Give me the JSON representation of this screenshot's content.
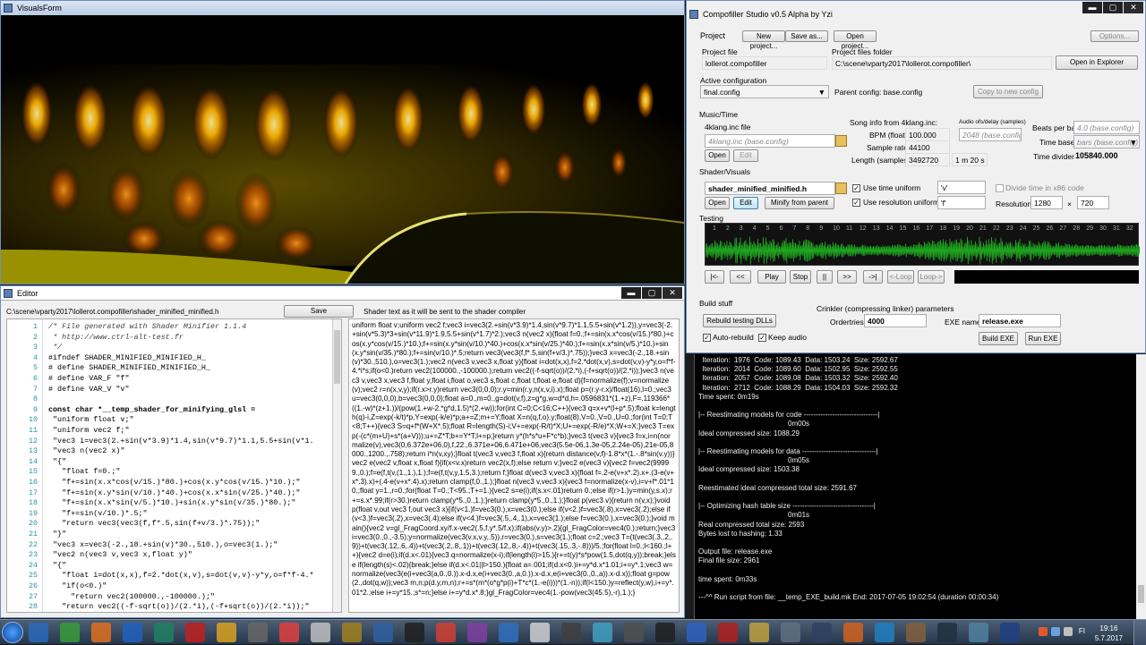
{
  "visuals": {
    "title": "VisualsForm"
  },
  "editor": {
    "title": "Editor",
    "path": "C:\\scene\\vparty2017\\lollerot.compofiller\\shader_minified_minified.h",
    "save_label": "Save",
    "shader_note": "Shader text as it will be sent to the shader compiler",
    "lines": [
      {
        "n": "1",
        "t": "/* File generated with Shader Minifier 1.1.4",
        "c": "cm"
      },
      {
        "n": "2",
        "t": " * http://www.ctrl-alt-test.fr",
        "c": "cm"
      },
      {
        "n": "3",
        "t": " */",
        "c": "cm"
      },
      {
        "n": "4",
        "t": "#ifndef SHADER_MINIFIED_MINIFIED_H_",
        "c": ""
      },
      {
        "n": "5",
        "t": "# define SHADER_MINIFIED_MINIFIED_H_",
        "c": ""
      },
      {
        "n": "6",
        "t": "# define VAR_F \"f\"",
        "c": ""
      },
      {
        "n": "7",
        "t": "# define VAR_V \"v\"",
        "c": ""
      },
      {
        "n": "8",
        "t": "",
        "c": ""
      },
      {
        "n": "9",
        "t": "const char *__temp_shader_for_minifying_glsl =",
        "c": "kw"
      },
      {
        "n": "10",
        "t": " \"uniform float v;\"",
        "c": ""
      },
      {
        "n": "11",
        "t": " \"uniform vec2 f;\"",
        "c": ""
      },
      {
        "n": "12",
        "t": " \"vec3 i=vec3(2.+sin(v*3.9)*1.4,sin(v*9.7)*1.1,5.5+sin(v*1.",
        "c": ""
      },
      {
        "n": "13",
        "t": " \"vec3 n(vec2 x)\"",
        "c": ""
      },
      {
        "n": "14",
        "t": " \"{\"",
        "c": ""
      },
      {
        "n": "15",
        "t": "   \"float f=0.;\"",
        "c": ""
      },
      {
        "n": "16",
        "t": "   \"f+=sin(x.x*cos(v/15.)*80.)+cos(x.y*cos(v/15.)*10.);\"",
        "c": ""
      },
      {
        "n": "17",
        "t": "   \"f+=sin(x.y*sin(v/10.)*40.)+cos(x.x*sin(v/25.)*40.);\"",
        "c": ""
      },
      {
        "n": "18",
        "t": "   \"f+=sin(x.x*sin(v/5.)*10.)+sin(x.y*sin(v/35.)*80.);\"",
        "c": ""
      },
      {
        "n": "19",
        "t": "   \"f+=sin(v/10.)*.5;\"",
        "c": ""
      },
      {
        "n": "20",
        "t": "   \"return vec3(vec3(f,f*.5,sin(f+v/3.)*.75));\"",
        "c": ""
      },
      {
        "n": "21",
        "t": " \"}\"",
        "c": ""
      },
      {
        "n": "22",
        "t": " \"vec3 x=vec3(-2.,18.+sin(v)*30.,510.),o=vec3(1.);\"",
        "c": ""
      },
      {
        "n": "23",
        "t": " \"vec2 n(vec3 v,vec3 x,float y)\"",
        "c": ""
      },
      {
        "n": "24",
        "t": " \"{\"",
        "c": ""
      },
      {
        "n": "25",
        "t": "   \"float i=dot(x,x),f=2.*dot(x,v),s=dot(v,v)-y*y,o=f*f-4.*",
        "c": ""
      },
      {
        "n": "26",
        "t": "   \"if(o<0.)\"",
        "c": ""
      },
      {
        "n": "27",
        "t": "     \"return vec2(100000.,-100000.);\"",
        "c": ""
      },
      {
        "n": "28",
        "t": "   \"return vec2((-f-sqrt(o))/(2.*i),(-f+sqrt(o))/(2.*i));\"",
        "c": ""
      }
    ],
    "output": "uniform float v;uniform vec2 f;vec3 i=vec3(2.+sin(v*3.9)*1.4,sin(v*9.7)*1.1,5.5+sin(v*1.2)),y=vec3(-2.+sin(v*5.3)*3+sin(v*11.9)*1.9,5.5+sin(v*1.7)*2.);vec3 n(vec2 x){float f=0.;f+=sin(x.x*cos(v/15.)*80.)+cos(x.y*cos(v/15.)*10.);f+=sin(x.y*sin(v/10.)*40.)+cos(x.x*sin(v/25.)*40.);f+=sin(x.x*sin(v/5.)*10.)+sin(x.y*sin(v/35.)*80.);f+=sin(v/10.)*.5;return vec3(vec3(f,f*.5,sin(f+v/3.)*.75));}vec3 x=vec3(-2.,18.+sin(v)*30.,510.),o=vec3(1.);vec2 n(vec3 v,vec3 x,float y){float i=dot(x,x),f=2.*dot(x,v),s=dot(v,v)-y*y,o=f*f-4.*i*s;if(o<0.)return vec2(100000.,-100000.);return vec2((-f-sqrt(o))/(2.*i),(-f+sqrt(o))/(2.*i));}vec3 n(vec3 v,vec3 x,vec3 f,float y,float i,float o,vec3 s,float c,float t,float e,float d){f=normalize(f);v=normalize(v);vec2 r=n(x,v,y);if(r.x>r.y)return vec3(0,0,0);r.y=min(r.y,n(x,v,i).x);float p=(r.y-r.x)/float(16),l=0.;vec3 u=vec3(0,0,0),b=vec3(0,0,0);float a=0.,m=0.,g=dot(v,f),z=g*g,w=d*d,h=.0596831*(1.+z),F=.119366*((1.-w)*(z+1.))/(pow(1.+w-2.*g*d,1.5)*(2.+w));for(int C=0;C<16;C++){vec3 q=x+v*(l+p*.5);float k=length(q)-i,Z=exp(-k/t)*p,Y=exp(-k/e)*p;a+=Z;m+=Y;float X=n(q,f,o).y;float(8),V=0.,V=0.,U=0.;for(int T=0;T<8;T++){vec3 S=q+f*(W+X*.5);float R=length(S)-i;V+=exp(-R/t)*X;U+=exp(-R/e)*X;W+=X;}vec3 T=exp(-(c*(m+U)+s*(a+V)));u+=Z*T;b+=Y*T;l+=p;}return y*(h*s*u+F*c*b);}vec3 t(vec3 v){vec3 f=x,i=n(normalize(v),vec3(0,6.372e+06,0),f,22.,6.371e+06,6.471e+06,vec3(5.5e-06,1.3e-05,2.24e-05),21e-05,8000.,1200.,.758);return i*n(v,xy);}float t(vec3 v,vec3 f,float x){return distance(v,f)-1.8*x*(1.-.8*sin(v.y))}vec2 e(vec2 v,float x,float f){if(x<v.x)return vec2(x,f);else return v;}vec2 e(vec3 v){vec2 f=vec2(99999.,0.);f=e(f,t(v,(1.,1.),1.);f=e(f,t(v,y,1.5,3.);return f;}float d(vec3 v,vec3 x){float f=.2-e(v+x*.2).x+.(3-e(v+x*.3).x)+(.4-e(v+x*.4).x);return clamp(f,0.,1.);}float n(vec3 v,vec3 x){vec3 f=normalize(x-v),i=v+f*.01*10.;float y=1.,r=0.;for(float T=0.;T<95.;T+=1.){vec2 s=e(i);if(s.x<.01)return 0.;else if(r>1.)y=min(y,s.x);r+=s.x*.99;if(r>30.)return clamp(y*5.,0.,1.);}return clamp(y*5.,0.,1.);}float p(vec3 v){return n(v,x);}void p(float v,out vec3 f,out vec3 x){if(v<1.)f=vec3(0.),x=vec3(0.);else if(v<2.)f=vec3(.8),x=vec3(.2);else if(v<3.)f=vec3(.2),x=vec3(.4);else if(v<4.)f=vec3(.5,.4,.1),x=vec3(1.);else f=vec3(0.),x=vec3(0.);}void main(){vec2 v=gl_FragCoord.xy/f.x-vec2(.5,f.y*.5/f.x);if(abs(v.y)>.2){gl_FragColor=vec4(0.);return;}vec3 i=vec3(0.,0.,-3.5);y=normalize(vec3(v.x,v.y,.5)),r=vec3(0.),s=vec3(1.);float c=2.;vec3 T=(t(vec3(.3,.2,.9))+t(vec3(.12,.6,.4))+t(vec3(.2,.8,.1))+t(vec3(.12,.8,-.4))+t(vec3(.15,.3,-.8)))/5.;for(float l=0.;l<160.;l++){vec2 d=e(i);if(d.x<.01){vec3 q=normalize(x-i);if(length(i)>15.){r+=t(y)*s*pow(1.5,dot(q,y));break;}else if(length(s)<.02){break;}else if(d.x<.01||l>150.){float a=.001;if(d.x<0.)i+=y*d.x*1.01;i+=y*.1;vec3 w=normalize(vec3(e(i+vec3(a,0.,0.)).x-d.x,e(i+vec3(0.,a,0.)).x-d.x,e(i+vec3(0.,0.,a)).x-d.x));float g=pow(2.,dot(q,w));vec3 m,n;p(d.y,m,n);r+=s*(m*(o*g*p(i)+T*c*(1.-e(i)))*(1.-n));if(l<150.)y=reflect(y,w),i+=y*.01*2.;else i+=y*15.;s*=n;}else i+=y*d.x*.8;}gl_FragColor=vec4(1.-pow(vec3(45.5),-r),1.);}"
  },
  "studio": {
    "title": "Compofiller Studio v0.5 Alpha by Yzi",
    "project_label": "Project",
    "new_project": "New project...",
    "save_as": "Save as...",
    "open_project": "Open project...",
    "options": "Options...",
    "project_file_label": "Project file",
    "project_file": "lollerot.compofiller",
    "folder_label": "Project files folder",
    "folder": "C:\\scene\\vparty2017\\lollerot.compofiller\\",
    "open_explorer": "Open in Explorer",
    "active_config_label": "Active configuration",
    "active_config": "final.config",
    "parent_config": "Parent config: base.config",
    "copy_config": "Copy to new config",
    "music_time": "Music/Time",
    "klang_file_label": "4klang.inc file",
    "klang_file": "4klang.inc (base.config)",
    "open": "Open",
    "edit": "Edit",
    "song_info": "Song info from 4klang.inc:",
    "bpm_label": "BPM (float)",
    "bpm": "100.000",
    "rate_label": "Sample rate",
    "rate": "44100",
    "length_label": "Length (samples)",
    "length": "3492720",
    "length_time": "1 m 20 s",
    "audio_delay_label": "Audio ofs/delay (samples)",
    "audio_delay": "2048 (base.config)",
    "beats_label": "Beats per bar",
    "beats": "4.0 (base.config)",
    "timebase_label": "Time base",
    "timebase": "bars (base.config)",
    "divider_label": "Time divider",
    "divider": "105840.000",
    "shader_visuals": "Shader/Visuals",
    "shader_file": "shader_minified_minified.h",
    "minify": "Minify from parent",
    "use_time": "Use time uniform",
    "time_uniform": "'v'",
    "use_res": "Use resolution uniform",
    "res_uniform": "'f'",
    "divide_time": "Divide time in x86 code",
    "resolution_label": "Resolution",
    "res_w": "1280",
    "res_x": "×",
    "res_h": "720",
    "testing": "Testing",
    "bar_numbers": [
      "1",
      "2",
      "3",
      "4",
      "5",
      "6",
      "7",
      "8",
      "9",
      "10",
      "11",
      "12",
      "13",
      "14",
      "15",
      "16",
      "17",
      "18",
      "19",
      "20",
      "21",
      "22",
      "23",
      "24",
      "25",
      "26",
      "27",
      "28",
      "29",
      "30",
      "31",
      "32"
    ],
    "transport": [
      "|<-",
      "<<",
      "Play",
      "Stop",
      "||",
      ">>",
      "->|",
      "<-Loop",
      "Loop->"
    ],
    "build_stuff": "Build stuff",
    "rebuild": "Rebuild testing DLLs",
    "auto_rebuild": "Auto-rebuild",
    "keep_audio": "Keep audio",
    "crinkler": "Crinkler (compressing linker) parameters",
    "orderties_label": "Ordertries",
    "orderties": "4000",
    "exe_label": "EXE name",
    "exe": "release.exe",
    "build_exe": "Build EXE",
    "run_exe": "Run EXE"
  },
  "console": [
    "  Iteration:  1976  Code: 1089.43  Data: 1503.24  Size: 2592.67",
    "  Iteration:  2014  Code: 1089.60  Data: 1502.95  Size: 2592.55",
    "  Iteration:  2057  Code: 1089.08  Data: 1503.32  Size: 2592.40",
    "  Iteration:  2712  Code: 1088.29  Data: 1504.03  Size: 2592.32",
    "Time spent: 0m19s",
    "",
    "|-- Reestimating models for code -------------------------------|",
    "                                             0m00s",
    "Ideal compressed size: 1088.29",
    "",
    "|-- Reestimating models for data -------------------------------|",
    "                                             0m05s",
    "Ideal compressed size: 1503.38",
    "",
    "Reestimated ideal compressed total size: 2591.67",
    "",
    "|-- Optimizing hash table size ----------------------------------|",
    "                                             0m01s",
    "Real compressed total size: 2593",
    "Bytes lost to hashing: 1.33",
    "",
    "Output file: release.exe",
    "Final file size: 2961",
    "",
    "time spent: 0m33s",
    "",
    "---^^ Run script from file: __temp_EXE_build.mk End: 2017-07-05 19:02:54 (duration 00:00:34)"
  ],
  "taskbar": {
    "time": "19:16",
    "date": "5.7.2017",
    "lang": "FI"
  }
}
